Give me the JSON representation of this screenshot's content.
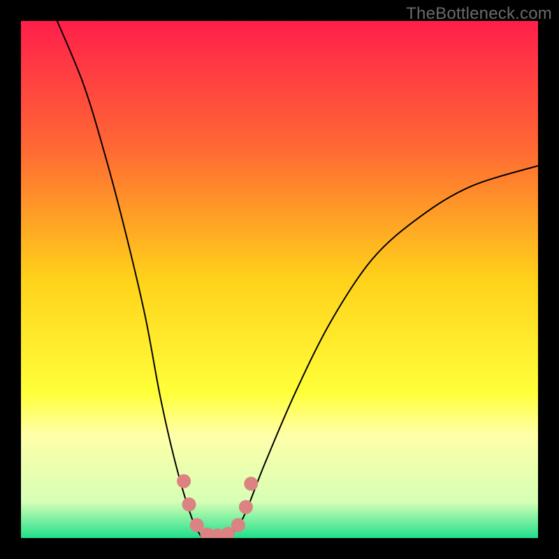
{
  "watermark": "TheBottleneck.com",
  "chart_data": {
    "type": "line",
    "title": "",
    "xlabel": "",
    "ylabel": "",
    "xlim": [
      0,
      100
    ],
    "ylim": [
      0,
      100
    ],
    "grid": false,
    "legend": false,
    "background_gradient": {
      "stops": [
        {
          "offset": 0.0,
          "color": "#ff1f4b"
        },
        {
          "offset": 0.25,
          "color": "#ff6a33"
        },
        {
          "offset": 0.5,
          "color": "#ffd21a"
        },
        {
          "offset": 0.72,
          "color": "#ffff3a"
        },
        {
          "offset": 0.8,
          "color": "#ffffa8"
        },
        {
          "offset": 0.93,
          "color": "#d6ffb5"
        },
        {
          "offset": 1.0,
          "color": "#1fe08c"
        }
      ]
    },
    "series": [
      {
        "name": "left-branch",
        "color": "#000000",
        "x": [
          7,
          12,
          16,
          20,
          24,
          27,
          30,
          33,
          35
        ],
        "y": [
          100,
          88,
          75,
          60,
          43,
          27,
          14,
          4,
          0
        ]
      },
      {
        "name": "right-branch",
        "color": "#000000",
        "x": [
          40,
          43,
          47,
          53,
          60,
          68,
          77,
          87,
          100
        ],
        "y": [
          0,
          4,
          14,
          28,
          42,
          54,
          62,
          68,
          72
        ]
      }
    ],
    "markers": {
      "name": "bottom-dots",
      "color": "#dc8282",
      "points": [
        {
          "x": 31.5,
          "y": 11
        },
        {
          "x": 32.5,
          "y": 6.5
        },
        {
          "x": 34.0,
          "y": 2.5
        },
        {
          "x": 36.0,
          "y": 0.7
        },
        {
          "x": 38.0,
          "y": 0.5
        },
        {
          "x": 40.0,
          "y": 0.8
        },
        {
          "x": 42.0,
          "y": 2.5
        },
        {
          "x": 43.5,
          "y": 6
        },
        {
          "x": 44.5,
          "y": 10.5
        }
      ]
    }
  }
}
